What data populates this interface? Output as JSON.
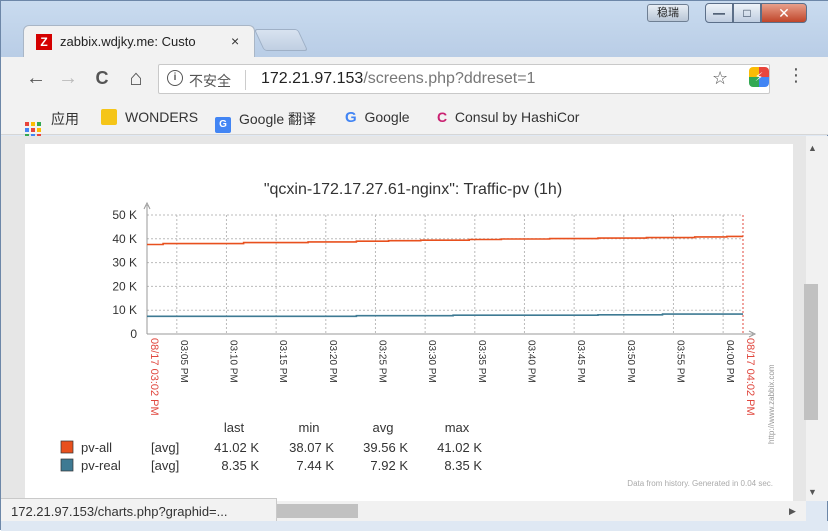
{
  "window": {
    "ime_label": "稳瑞",
    "minimize_symbol": "—",
    "maximize_symbol": "□",
    "close_symbol": "✕"
  },
  "tab": {
    "favicon_letter": "Z",
    "title": "zabbix.wdjky.me: Custo",
    "close_symbol": "×"
  },
  "toolbar": {
    "back_symbol": "←",
    "forward_symbol": "→",
    "reload_symbol": "C",
    "home_symbol": "⌂",
    "security_label": "不安全",
    "url_host": "172.21.97.153",
    "url_path": "/screens.php?ddreset=1",
    "star_symbol": "☆",
    "menu_symbol": "⋮",
    "info_symbol": "i"
  },
  "bookmarks": [
    {
      "label": "应用",
      "icon": "apps-grid-icon"
    },
    {
      "label": "WONDERS",
      "icon": "folder-icon"
    },
    {
      "label": "Google 翻译",
      "icon": "google-translate-icon"
    },
    {
      "label": "Google",
      "icon": "google-icon"
    },
    {
      "label": "Consul by HashiCor",
      "icon": "consul-icon"
    }
  ],
  "status_bar": {
    "url": "172.21.97.153/charts.php?graphid=..."
  },
  "colors": {
    "series_all": "#e8501e",
    "series_real": "#3e7a93",
    "time_red": "#e0473e"
  },
  "chart_data": {
    "type": "line",
    "title": "\"qcxin-172.17.27.61-nginx\": Traffic-pv (1h)",
    "y_ticks": [
      "50 K",
      "40 K",
      "30 K",
      "20 K",
      "10 K",
      "0"
    ],
    "ylim": [
      0,
      50000
    ],
    "grid": true,
    "x_ticks": [
      "03:05 PM",
      "03:10 PM",
      "03:15 PM",
      "03:20 PM",
      "03:25 PM",
      "03:30 PM",
      "03:35 PM",
      "03:40 PM",
      "03:45 PM",
      "03:50 PM",
      "03:55 PM",
      "04:00 PM"
    ],
    "x_start_label": "08/17 03:02 PM",
    "x_end_label": "08/17 04:02 PM",
    "watermark": "http://www.zabbix.com",
    "series": [
      {
        "name": "pv-all",
        "func": "[avg]",
        "values": [
          37600,
          38000,
          38000,
          38000,
          38000,
          38000,
          38400,
          38400,
          38400,
          38400,
          38700,
          38700,
          38700,
          39000,
          39000,
          39200,
          39200,
          39400,
          39400,
          39400,
          39700,
          39700,
          39900,
          39900,
          39900,
          40100,
          40100,
          40100,
          40300,
          40300,
          40300,
          40500,
          40500,
          40500,
          40800,
          40800,
          41020
        ]
      },
      {
        "name": "pv-real",
        "func": "[avg]",
        "values": [
          7440,
          7440,
          7440,
          7440,
          7440,
          7440,
          7440,
          7440,
          7440,
          7440,
          7440,
          7440,
          7440,
          7700,
          7700,
          7700,
          7700,
          7700,
          7700,
          7900,
          7900,
          7900,
          7900,
          7900,
          7900,
          7900,
          7900,
          7900,
          8050,
          8050,
          8050,
          8050,
          8350,
          8350,
          8350,
          8350,
          8350
        ]
      }
    ],
    "legend": {
      "headers": [
        "last",
        "min",
        "avg",
        "max"
      ],
      "rows": [
        {
          "name": "pv-all",
          "func": "[avg]",
          "last": "41.02 K",
          "min": "38.07 K",
          "avg": "39.56 K",
          "max": "41.02 K"
        },
        {
          "name": "pv-real",
          "func": "[avg]",
          "last": "8.35 K",
          "min": "7.44 K",
          "avg": "7.92 K",
          "max": "8.35 K"
        }
      ]
    },
    "footer_note": "Data from history. Generated in 0.04 sec."
  }
}
